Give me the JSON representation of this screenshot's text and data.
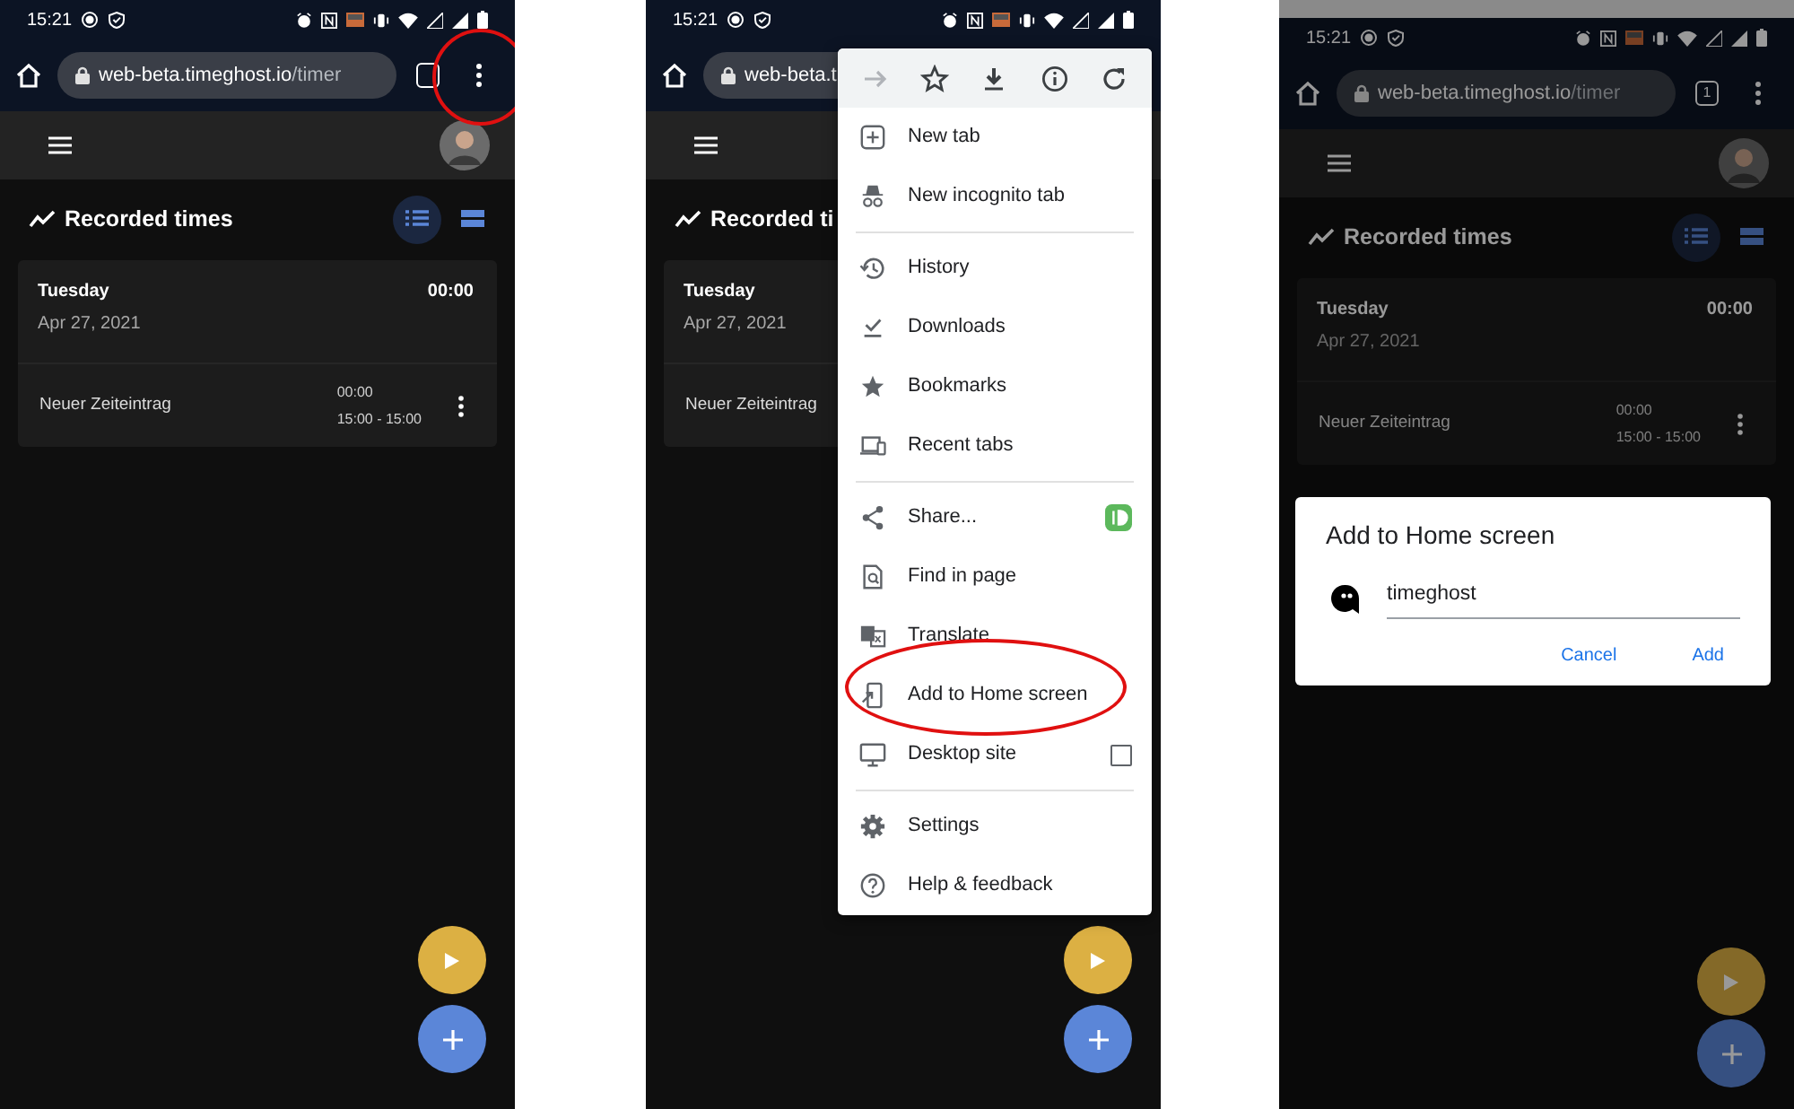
{
  "panels": [
    {
      "kind": "plain",
      "status_bar": {
        "time": "15:21"
      },
      "browser": {
        "url_host": "web-beta.timeghost.io",
        "url_path": "/timer",
        "menu_button_circled": true
      },
      "section_title": "Recorded times",
      "view_toggle": [
        {
          "selected": true
        },
        {
          "selected": false
        }
      ],
      "day": {
        "name": "Tuesday",
        "date": "Apr 27, 2021",
        "total": "00:00"
      },
      "entry": {
        "title": "Neuer Zeiteintrag",
        "duration": "00:00",
        "range": "15:00 - 15:00"
      }
    },
    {
      "kind": "menu",
      "status_bar": {
        "time": "15:21"
      },
      "browser": {
        "url_host": "web-beta.t"
      },
      "section_title": "Recorded ti",
      "day": {
        "name": "Tuesday",
        "date": "Apr 27, 2021"
      },
      "entry": {
        "title": "Neuer Zeiteintrag"
      },
      "menu_actions": [
        {
          "disabled": true
        },
        {
          "disabled": false
        },
        {
          "disabled": false
        },
        {
          "disabled": false
        },
        {
          "disabled": false
        }
      ],
      "menu_groups": [
        [
          {
            "label": "New tab"
          },
          {
            "label": "New incognito tab"
          }
        ],
        [
          {
            "label": "History"
          },
          {
            "label": "Downloads"
          },
          {
            "label": "Bookmarks"
          },
          {
            "label": "Recent tabs"
          }
        ],
        [
          {
            "label": "Share...",
            "kind": "share"
          },
          {
            "label": "Find in page"
          },
          {
            "label": "Translate"
          },
          {
            "label": "Add to Home screen",
            "circled": true
          },
          {
            "label": "Desktop site",
            "kind": "checkbox",
            "checked": false
          }
        ],
        [
          {
            "label": "Settings"
          },
          {
            "label": "Help & feedback"
          }
        ]
      ]
    },
    {
      "kind": "dialog",
      "status_bar": {
        "time": "15:21"
      },
      "browser": {
        "url_host": "web-beta.timeghost.io",
        "url_path": "/timer",
        "tab_count": "1"
      },
      "section_title": "Recorded times",
      "view_toggle": [
        {
          "selected": true
        },
        {
          "selected": false
        }
      ],
      "day": {
        "name": "Tuesday",
        "date": "Apr 27, 2021",
        "total": "00:00"
      },
      "entry": {
        "title": "Neuer Zeiteintrag",
        "duration": "00:00",
        "range": "15:00 - 15:00"
      },
      "dialog": {
        "title": "Add to Home screen",
        "value": "timeghost",
        "buttons": [
          "Cancel",
          "Add"
        ]
      }
    }
  ]
}
